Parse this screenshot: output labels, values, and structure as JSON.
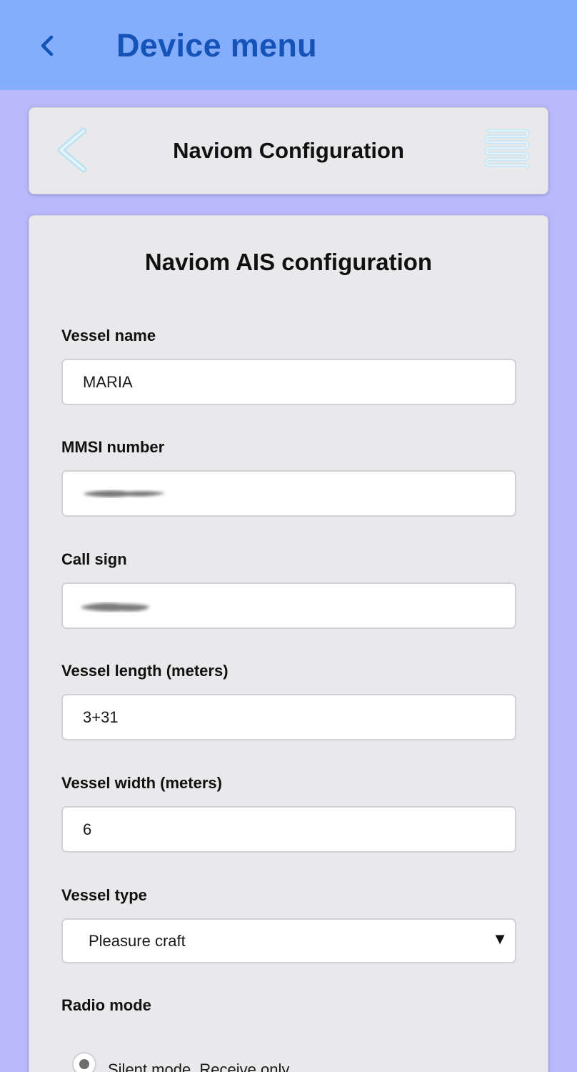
{
  "app_bar": {
    "title": "Device menu",
    "back_icon": "chevron-left-icon",
    "background": "#84aefc",
    "title_color": "#1553b8"
  },
  "header_card": {
    "title": "Naviom Configuration",
    "back_icon": "chevron-left-icon",
    "menu_icon": "hamburger-menu-icon"
  },
  "form": {
    "title": "Naviom AIS configuration",
    "vessel_name": {
      "label": "Vessel name",
      "value": "MARIA"
    },
    "mmsi": {
      "label": "MMSI number",
      "value": ""
    },
    "call_sign": {
      "label": "Call sign",
      "value": ""
    },
    "vessel_length": {
      "label": "Vessel length (meters)",
      "value": "3+31"
    },
    "vessel_width": {
      "label": "Vessel width (meters)",
      "value": "6"
    },
    "vessel_type": {
      "label": "Vessel type",
      "value": "Pleasure craft",
      "caret": "▼"
    },
    "radio_mode": {
      "label": "Radio mode",
      "options": [
        {
          "label": "Silent mode. Receive only",
          "selected": true
        }
      ]
    }
  },
  "colors": {
    "page_background": "#b9b8fb",
    "card_background": "#e9e9eb"
  }
}
